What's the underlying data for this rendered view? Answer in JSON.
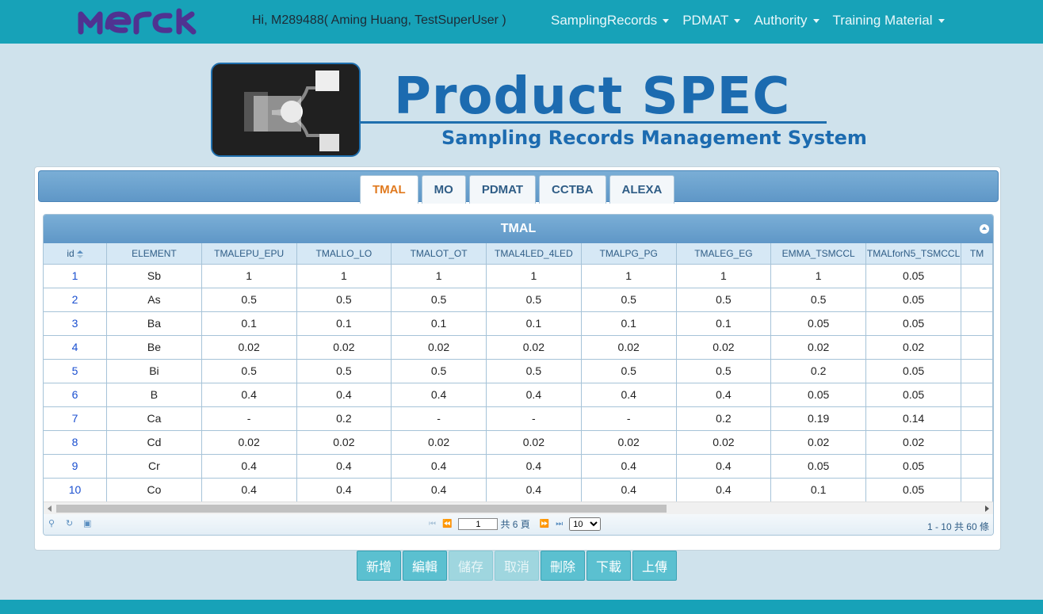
{
  "header": {
    "brand": "MERCK",
    "greeting": "Hi, M289488( Aming Huang, TestSuperUser )",
    "menu": [
      "SamplingRecords",
      "PDMAT",
      "Authority",
      "Training Material"
    ]
  },
  "banner": {
    "title": "Product SPEC",
    "subtitle": "Sampling Records Management System"
  },
  "tabs": [
    "TMAL",
    "MO",
    "PDMAT",
    "CCTBA",
    "ALEXA"
  ],
  "active_tab": "TMAL",
  "grid": {
    "caption": "TMAL",
    "columns": [
      "id",
      "ELEMENT",
      "TMALEPU_EPU",
      "TMALLO_LO",
      "TMALOT_OT",
      "TMAL4LED_4LED",
      "TMALPG_PG",
      "TMALEG_EG",
      "EMMA_TSMCCL",
      "TMALforN5_TSMCCL",
      "TM"
    ],
    "rows": [
      [
        "1",
        "Sb",
        "1",
        "1",
        "1",
        "1",
        "1",
        "1",
        "1",
        "0.05",
        ""
      ],
      [
        "2",
        "As",
        "0.5",
        "0.5",
        "0.5",
        "0.5",
        "0.5",
        "0.5",
        "0.5",
        "0.05",
        ""
      ],
      [
        "3",
        "Ba",
        "0.1",
        "0.1",
        "0.1",
        "0.1",
        "0.1",
        "0.1",
        "0.05",
        "0.05",
        ""
      ],
      [
        "4",
        "Be",
        "0.02",
        "0.02",
        "0.02",
        "0.02",
        "0.02",
        "0.02",
        "0.02",
        "0.02",
        ""
      ],
      [
        "5",
        "Bi",
        "0.5",
        "0.5",
        "0.5",
        "0.5",
        "0.5",
        "0.5",
        "0.2",
        "0.05",
        ""
      ],
      [
        "6",
        "B",
        "0.4",
        "0.4",
        "0.4",
        "0.4",
        "0.4",
        "0.4",
        "0.05",
        "0.05",
        ""
      ],
      [
        "7",
        "Ca",
        "-",
        "0.2",
        "-",
        "-",
        "-",
        "0.2",
        "0.19",
        "0.14",
        ""
      ],
      [
        "8",
        "Cd",
        "0.02",
        "0.02",
        "0.02",
        "0.02",
        "0.02",
        "0.02",
        "0.02",
        "0.02",
        ""
      ],
      [
        "9",
        "Cr",
        "0.4",
        "0.4",
        "0.4",
        "0.4",
        "0.4",
        "0.4",
        "0.05",
        "0.05",
        ""
      ],
      [
        "10",
        "Co",
        "0.4",
        "0.4",
        "0.4",
        "0.4",
        "0.4",
        "0.4",
        "0.1",
        "0.05",
        ""
      ]
    ],
    "pager": {
      "page_value": "1",
      "page_total_text": "共 6 頁",
      "rows_per_page": "10",
      "summary": "1 - 10 共 60 條"
    }
  },
  "actions": [
    {
      "label": "新增",
      "enabled": true
    },
    {
      "label": "編輯",
      "enabled": true
    },
    {
      "label": "儲存",
      "enabled": false
    },
    {
      "label": "取消",
      "enabled": false
    },
    {
      "label": "刪除",
      "enabled": true
    },
    {
      "label": "下載",
      "enabled": true
    },
    {
      "label": "上傳",
      "enabled": true
    }
  ],
  "colors": {
    "nav_bg": "#17a2b8",
    "page_bg": "#cfe2ec",
    "title_blue": "#1c6bb0",
    "brand_purple": "#503291",
    "active_tab_text": "#e07a1f"
  }
}
